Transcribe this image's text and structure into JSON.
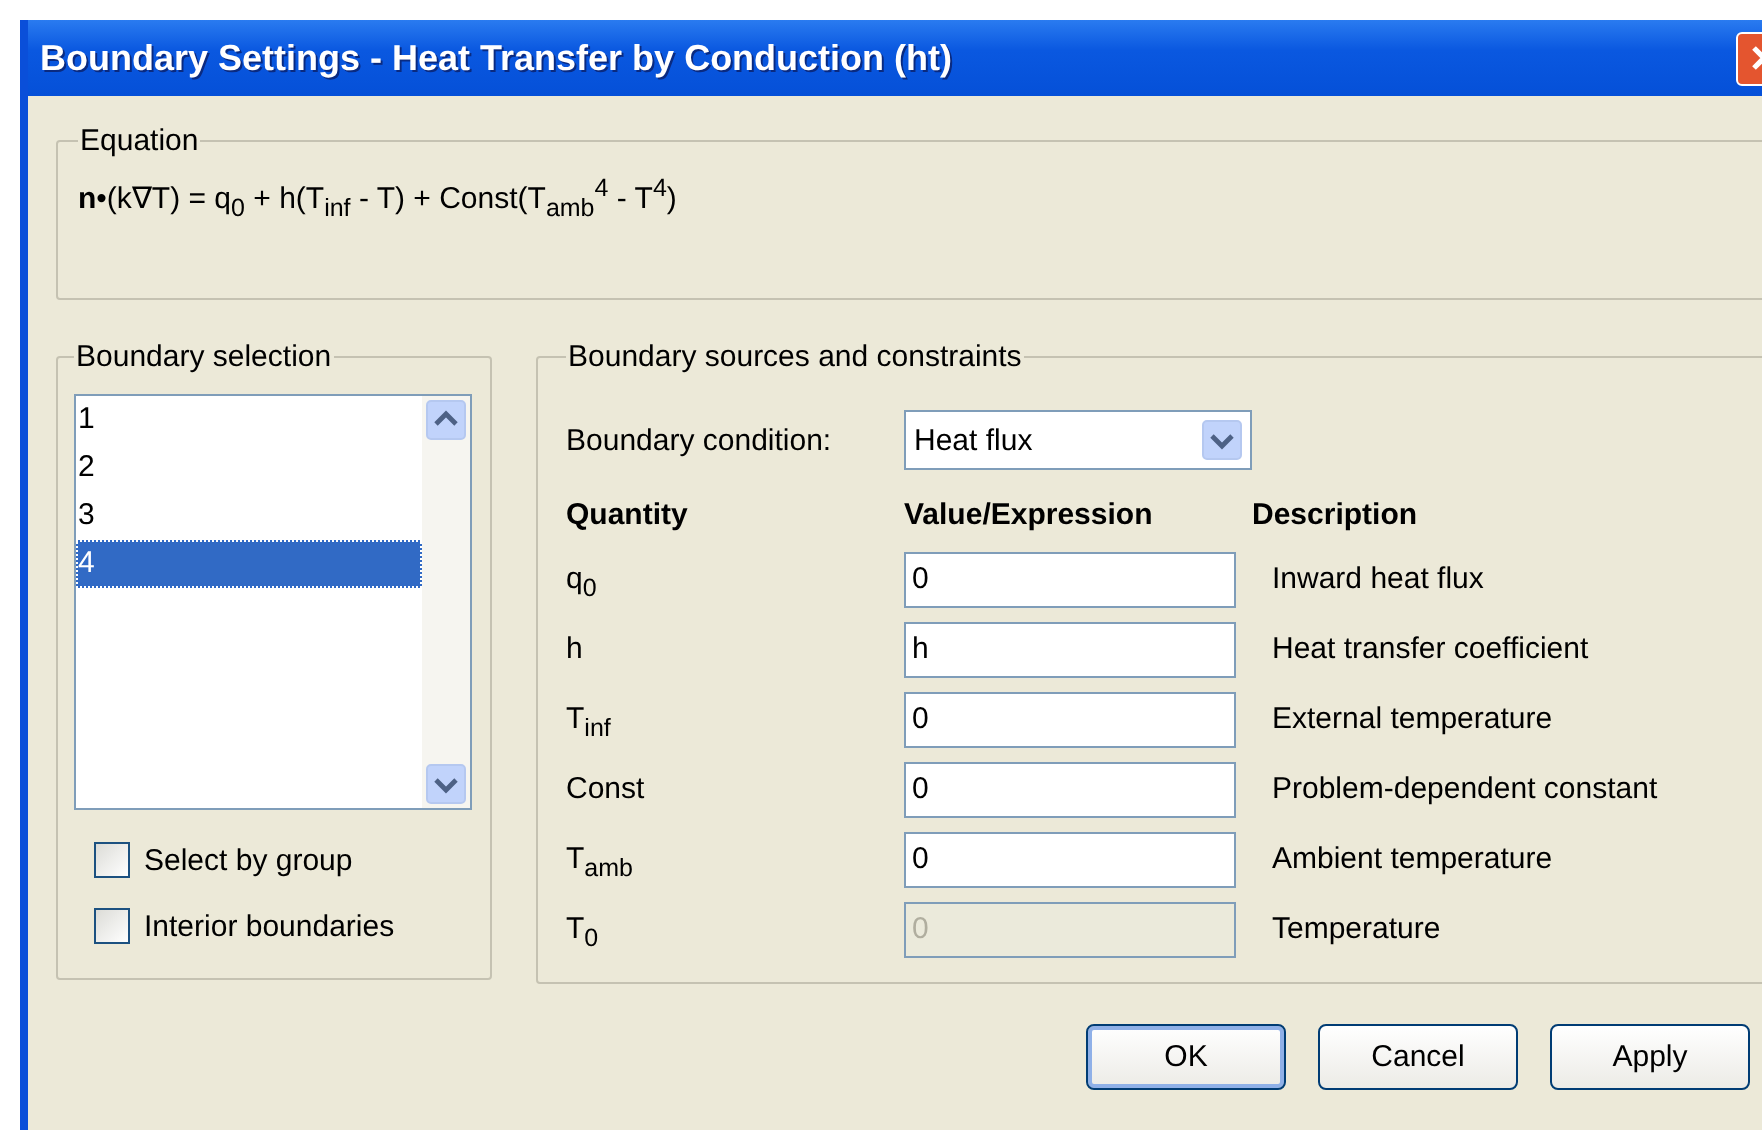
{
  "window": {
    "title": "Boundary Settings - Heat Transfer by Conduction (ht)"
  },
  "equation": {
    "label": "Equation",
    "formula": "**n**•(k∇T) = q$_{0}$ + h(T$_{inf}$ - T) + Const(T$_{amb}$$^{4}$ - T$^{4}$)"
  },
  "boundary_selection": {
    "label": "Boundary selection",
    "items": [
      {
        "label": "1",
        "selected": false
      },
      {
        "label": "2",
        "selected": false
      },
      {
        "label": "3",
        "selected": false
      },
      {
        "label": "4",
        "selected": true
      }
    ],
    "checkboxes": [
      {
        "label": "Select by group",
        "checked": false
      },
      {
        "label": "Interior boundaries",
        "checked": false
      }
    ]
  },
  "sources": {
    "label": "Boundary sources and constraints",
    "condition_label": "Boundary condition:",
    "condition_value": "Heat flux",
    "columns": [
      "Quantity",
      "Value/Expression",
      "Description"
    ],
    "rows": [
      {
        "quantity": "q$_{0}$",
        "value": "0",
        "description": "Inward heat flux",
        "disabled": false
      },
      {
        "quantity": "h",
        "value": "h",
        "description": "Heat transfer coefficient",
        "disabled": false
      },
      {
        "quantity": "T$_{inf}$",
        "value": "0",
        "description": "External temperature",
        "disabled": false
      },
      {
        "quantity": "Const",
        "value": "0",
        "description": "Problem-dependent constant",
        "disabled": false
      },
      {
        "quantity": "T$_{amb}$",
        "value": "0",
        "description": "Ambient temperature",
        "disabled": false
      },
      {
        "quantity": "T$_{0}$",
        "value": "0",
        "description": "Temperature",
        "disabled": true
      }
    ]
  },
  "buttons": [
    {
      "label": "OK",
      "default": true
    },
    {
      "label": "Cancel",
      "default": false
    },
    {
      "label": "Apply",
      "default": false
    }
  ]
}
